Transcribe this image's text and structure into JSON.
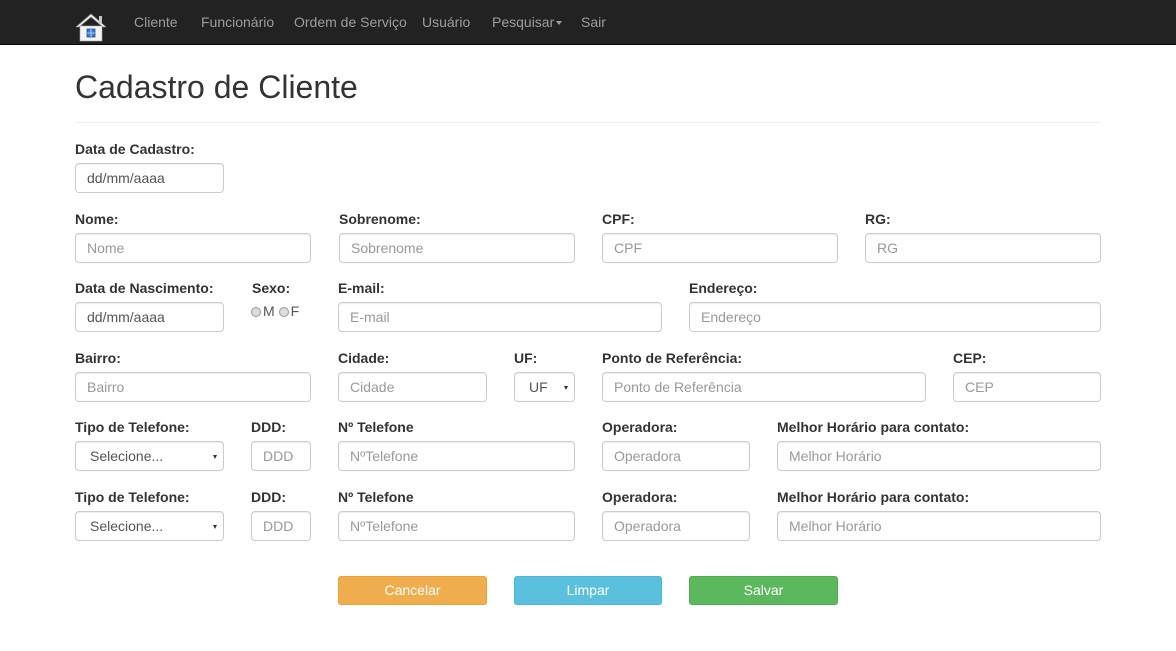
{
  "navbar": {
    "items": [
      "Cliente",
      "Funcionário",
      "Ordem de Serviço",
      "Usuário",
      "Pesquisar",
      "Sair"
    ]
  },
  "page": {
    "title": "Cadastro de Cliente"
  },
  "form": {
    "data_cadastro": {
      "label": "Data de Cadastro:",
      "value": "dd/mm/aaaa"
    },
    "nome": {
      "label": "Nome:",
      "placeholder": "Nome"
    },
    "sobrenome": {
      "label": "Sobrenome:",
      "placeholder": "Sobrenome"
    },
    "cpf": {
      "label": "CPF:",
      "placeholder": "CPF"
    },
    "rg": {
      "label": "RG:",
      "placeholder": "RG"
    },
    "nascimento": {
      "label": "Data de Nascimento:",
      "value": "dd/mm/aaaa"
    },
    "sexo": {
      "label": "Sexo:",
      "options": [
        "M",
        "F"
      ]
    },
    "email": {
      "label": "E-mail:",
      "placeholder": "E-mail"
    },
    "endereco": {
      "label": "Endereço:",
      "placeholder": "Endereço"
    },
    "bairro": {
      "label": "Bairro:",
      "placeholder": "Bairro"
    },
    "cidade": {
      "label": "Cidade:",
      "placeholder": "Cidade"
    },
    "uf": {
      "label": "UF:",
      "selected": "UF"
    },
    "ponto_referencia": {
      "label": "Ponto de Referência:",
      "placeholder": "Ponto de Referência"
    },
    "cep": {
      "label": "CEP:",
      "placeholder": "CEP"
    },
    "phones": [
      {
        "tipo_label": "Tipo de Telefone:",
        "tipo_selected": "Selecione...",
        "ddd_label": "DDD:",
        "ddd_placeholder": "DDD",
        "numero_label": "Nº Telefone",
        "numero_placeholder": "NºTelefone",
        "operadora_label": "Operadora:",
        "operadora_placeholder": "Operadora",
        "horario_label": "Melhor Horário para contato:",
        "horario_placeholder": "Melhor Horário"
      },
      {
        "tipo_label": "Tipo de Telefone:",
        "tipo_selected": "Selecione...",
        "ddd_label": "DDD:",
        "ddd_placeholder": "DDD",
        "numero_label": "Nº Telefone",
        "numero_placeholder": "NºTelefone",
        "operadora_label": "Operadora:",
        "operadora_placeholder": "Operadora",
        "horario_label": "Melhor Horário para contato:",
        "horario_placeholder": "Melhor Horário"
      }
    ]
  },
  "buttons": {
    "cancel": "Cancelar",
    "clear": "Limpar",
    "save": "Salvar"
  },
  "colors": {
    "navbar": "#222222",
    "warning": "#f0ad4e",
    "info": "#5bc0de",
    "success": "#5cb85c"
  },
  "icons": {
    "brand": "house-icon",
    "dropdown": "caret-down-icon"
  }
}
